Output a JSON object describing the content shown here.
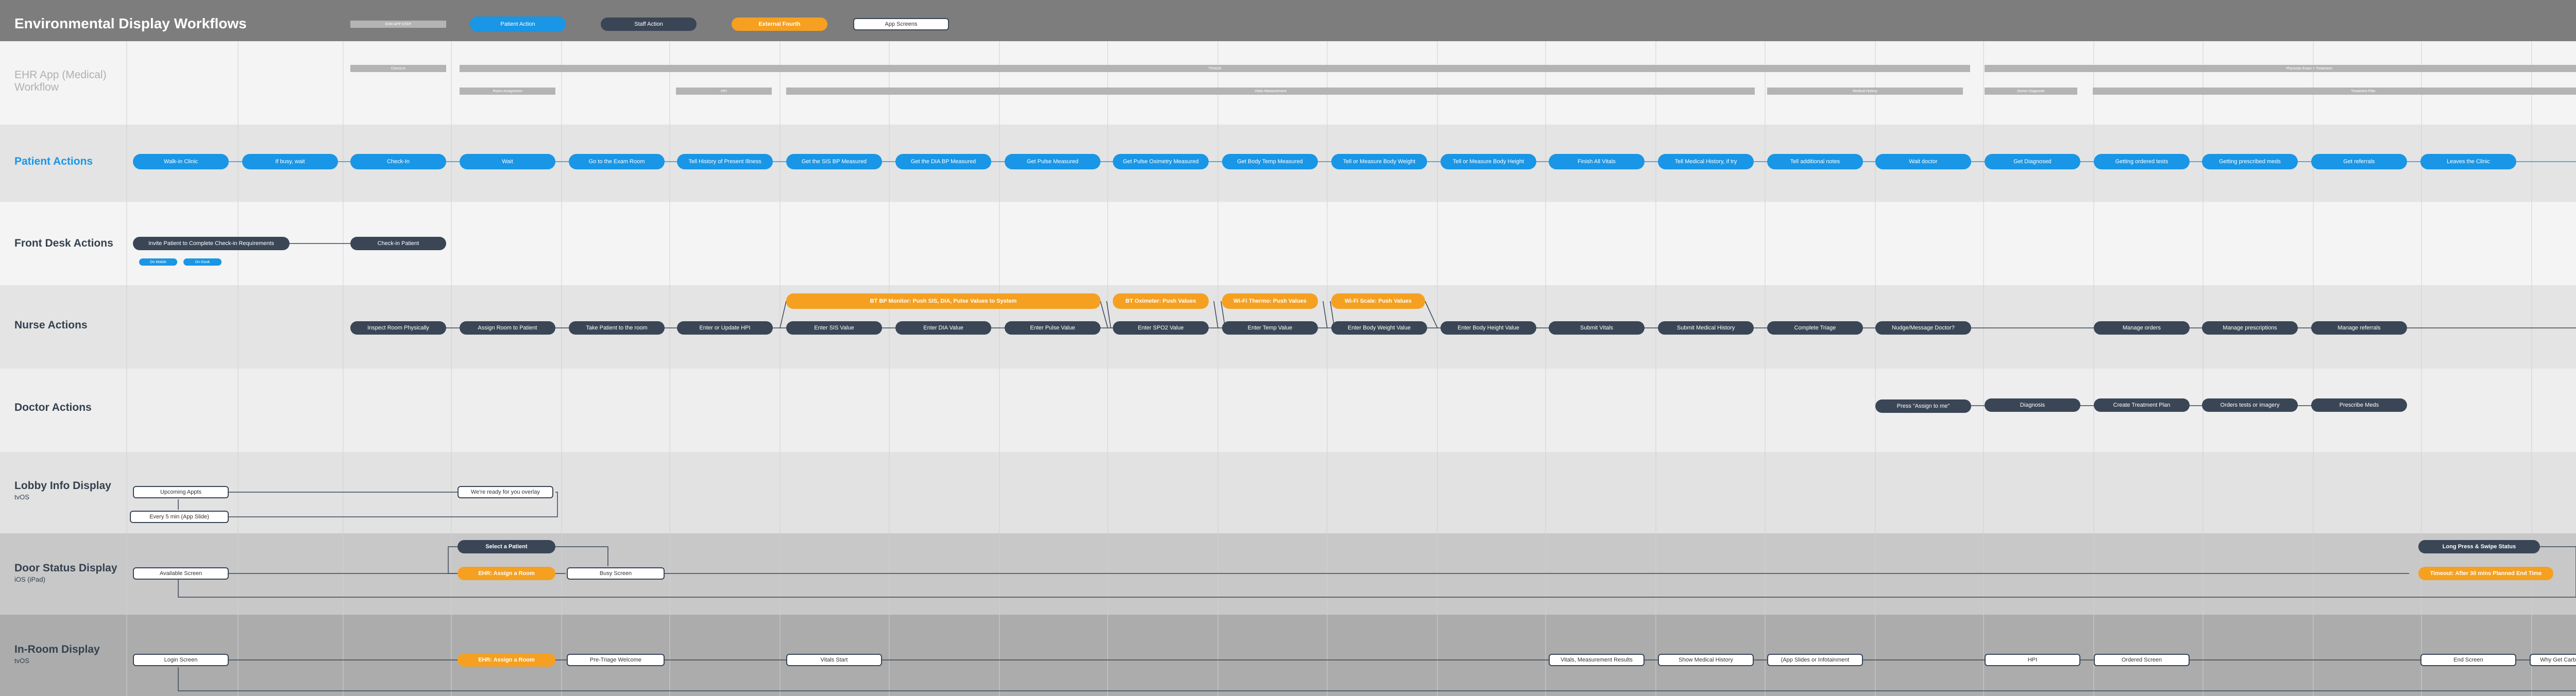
{
  "title": "Environmental Display Workflows",
  "legend": {
    "phase_title": "",
    "phase": "EHR APP STEP",
    "patient": "Patient Action",
    "staff": "Staff Action",
    "external": "External Fourth",
    "app": "App Screens"
  },
  "lanes": {
    "ehr": "EHR App (Medical) Workflow",
    "patient": "Patient Actions",
    "front_desk": "Front Desk Actions",
    "nurse": "Nurse Actions",
    "doctor": "Doctor Actions",
    "lobby": "Lobby Info Display",
    "lobby_sub": "tvOS",
    "door": "Door Status Display",
    "door_sub": "iOS (iPad)",
    "inroom": "In-Room Display",
    "inroom_sub": "tvOS"
  },
  "ehr_phases": {
    "row1": [
      "Check-In",
      "TRIAGE",
      "Physician Exam + Treatment"
    ],
    "row2": [
      "Room Assignment",
      "HPI",
      "Vitals Measurement",
      "Medical History",
      "Doctor Diagnosis",
      "Treatment Plan"
    ]
  },
  "patient_actions": [
    "Walk-in Clinic",
    "If busy, wait",
    "Check-In",
    "Wait",
    "Go to the Exam Room",
    "Tell History of Present Illness",
    "Get the SIS BP Measured",
    "Get the DIA BP Measured",
    "Get Pulse Measured",
    "Get Pulse Oximetry Measured",
    "Get Body Temp Measured",
    "Tell or Measure Body Weight",
    "Tell or Measure Body Height",
    "Finish All Vitals",
    "Tell Medical History, if try",
    "Tell additional notes",
    "Wait doctor",
    "Get Diagnosed",
    "Getting ordered tests",
    "Getting prescribed meds",
    "Get referrals",
    "Leaves the Clinic"
  ],
  "front_desk": {
    "invite": "Invite Patient to Complete Check-in Requirements",
    "checkin": "Check-in Patient",
    "tag1": "On Mobile",
    "tag2": "On Kiosk"
  },
  "nurse_actions": [
    "Inspect Room Physically",
    "Assign Room to Patient",
    "Take Patient to the room",
    "Enter or Update HPI",
    "Enter SIS Value",
    "Enter DIA Value",
    "Enter Pulse Value",
    "Enter SPO2 Value",
    "Enter Temp Value",
    "Enter Body Weight Value",
    "Enter Body Height Value",
    "Submit Vitals",
    "Submit Medical History",
    "Complete Triage",
    "Nudge/Message Doctor?",
    "Manage orders",
    "Manage prescriptions",
    "Manage referrals"
  ],
  "nurse_external": [
    "BT BP Monitor: Push SIS, DIA, Pulse Values to System",
    "BT Oximeter: Push Values",
    "Wi-Fi Thermo: Push Values",
    "Wi-Fi Scale: Push Values"
  ],
  "doctor_actions": [
    "Press \"Assign to me\"",
    "Diagnosis",
    "Create Treatment Plan",
    "Orders tests or imagery",
    "Prescribe Meds"
  ],
  "lobby": {
    "upcoming": "Upcoming Appts",
    "ready": "We're ready for you overlay",
    "slides": "Every 5 min (App Slide)"
  },
  "door": {
    "available": "Available Screen",
    "select": "Select a Patient",
    "ehr_assign": "EHR: Assign a Room",
    "busy": "Busy Screen",
    "long_press": "Long Press & Swipe Status",
    "timeout": "Timeout: After 30 mins Planned End Time"
  },
  "inroom": {
    "login": "Login Screen",
    "ehr_assign": "EHR: Assign a Room",
    "pre_triage": "Pre-Triage Welcome",
    "vitals_start": "Vitals Start",
    "vitals_results": "Vitals, Measurement Results",
    "med_history": "Show Medical History",
    "slides": "(App Slides or Infotainment",
    "hpi": "HPI",
    "ordered": "Ordered Screen",
    "end": "End Screen",
    "why": "Why Get Carbon? (App Slide)"
  },
  "colors": {
    "patient": "#1996e6",
    "staff": "#3a4656",
    "external": "#f5a021",
    "header": "#7d7d7d"
  }
}
